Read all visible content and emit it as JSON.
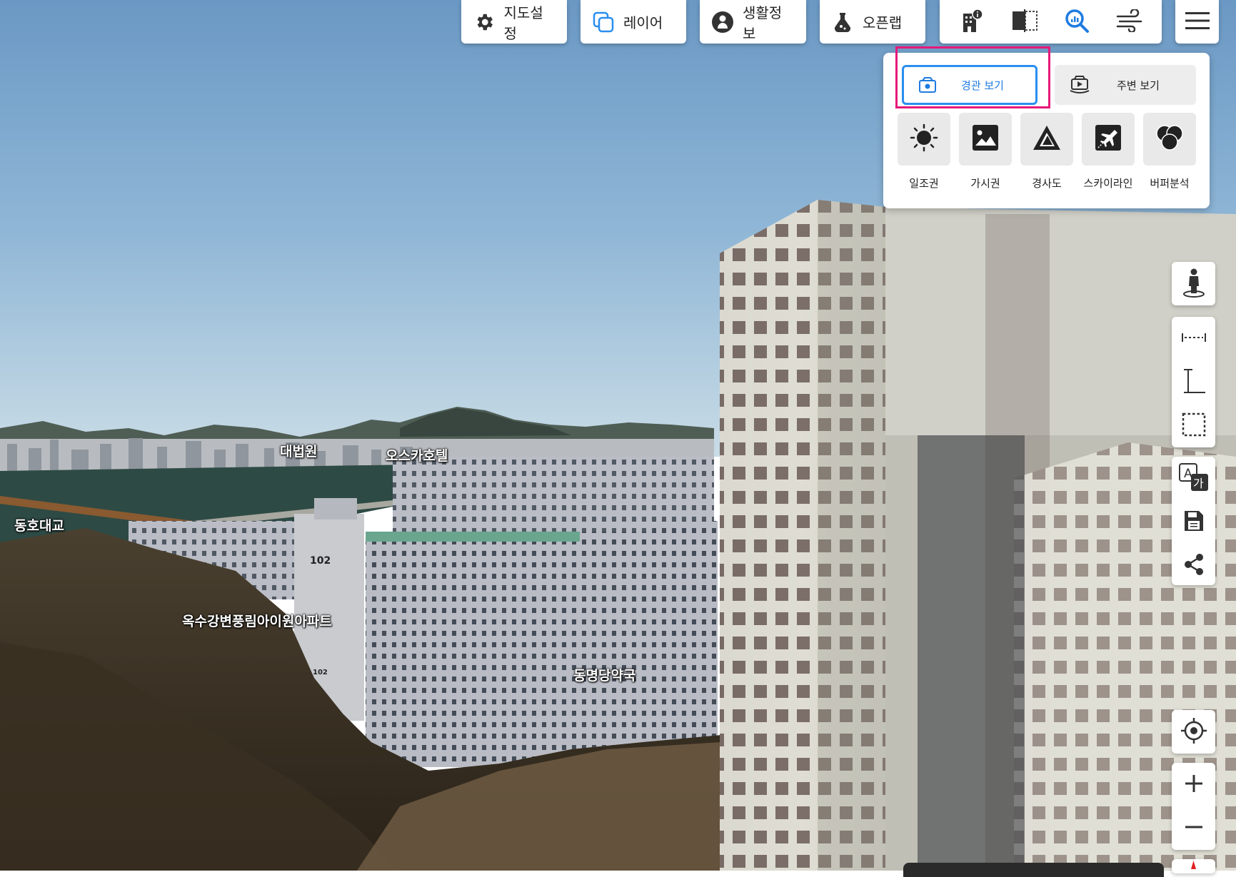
{
  "toolbar": {
    "map_settings_label": "지도설정",
    "layer_label": "레이어",
    "life_info_label": "생활정보",
    "open_lab_label": "오픈랩"
  },
  "tool_icons": [
    "building-info-icon",
    "split-view-icon",
    "analysis-search-icon",
    "wind-icon"
  ],
  "menu_icon": "hamburger-icon",
  "analysis_panel": {
    "tabs": [
      {
        "label": "경관 보기",
        "active": true
      },
      {
        "label": "주변 보기",
        "active": false
      }
    ],
    "tools": [
      {
        "label": "일조권",
        "icon": "sun-icon"
      },
      {
        "label": "가시권",
        "icon": "image-icon"
      },
      {
        "label": "경사도",
        "icon": "slope-triangle-icon"
      },
      {
        "label": "스카이라인",
        "icon": "skyline-plane-icon"
      },
      {
        "label": "버퍼분석",
        "icon": "buffer-circles-icon"
      }
    ],
    "highlight_color": "#e6197a",
    "accent_color": "#2a8ef0"
  },
  "map_labels": {
    "court": "대법원",
    "hotel": "오스카호텔",
    "bridge": "동호대교",
    "apartment": "옥수강변풍림아이원아파트",
    "pharmacy": "동명당약국",
    "building_number": "102",
    "building_number_low": "102"
  },
  "side_controls": {
    "street_view": "person-icon",
    "measure_distance": "ruler-horizontal-icon",
    "measure_height": "ruler-vertical-icon",
    "measure_area": "area-select-icon",
    "translate": "translate-icon",
    "save": "save-icon",
    "share": "share-icon",
    "locate": "locate-icon",
    "zoom_in": "plus-icon",
    "zoom_out": "minus-icon"
  }
}
